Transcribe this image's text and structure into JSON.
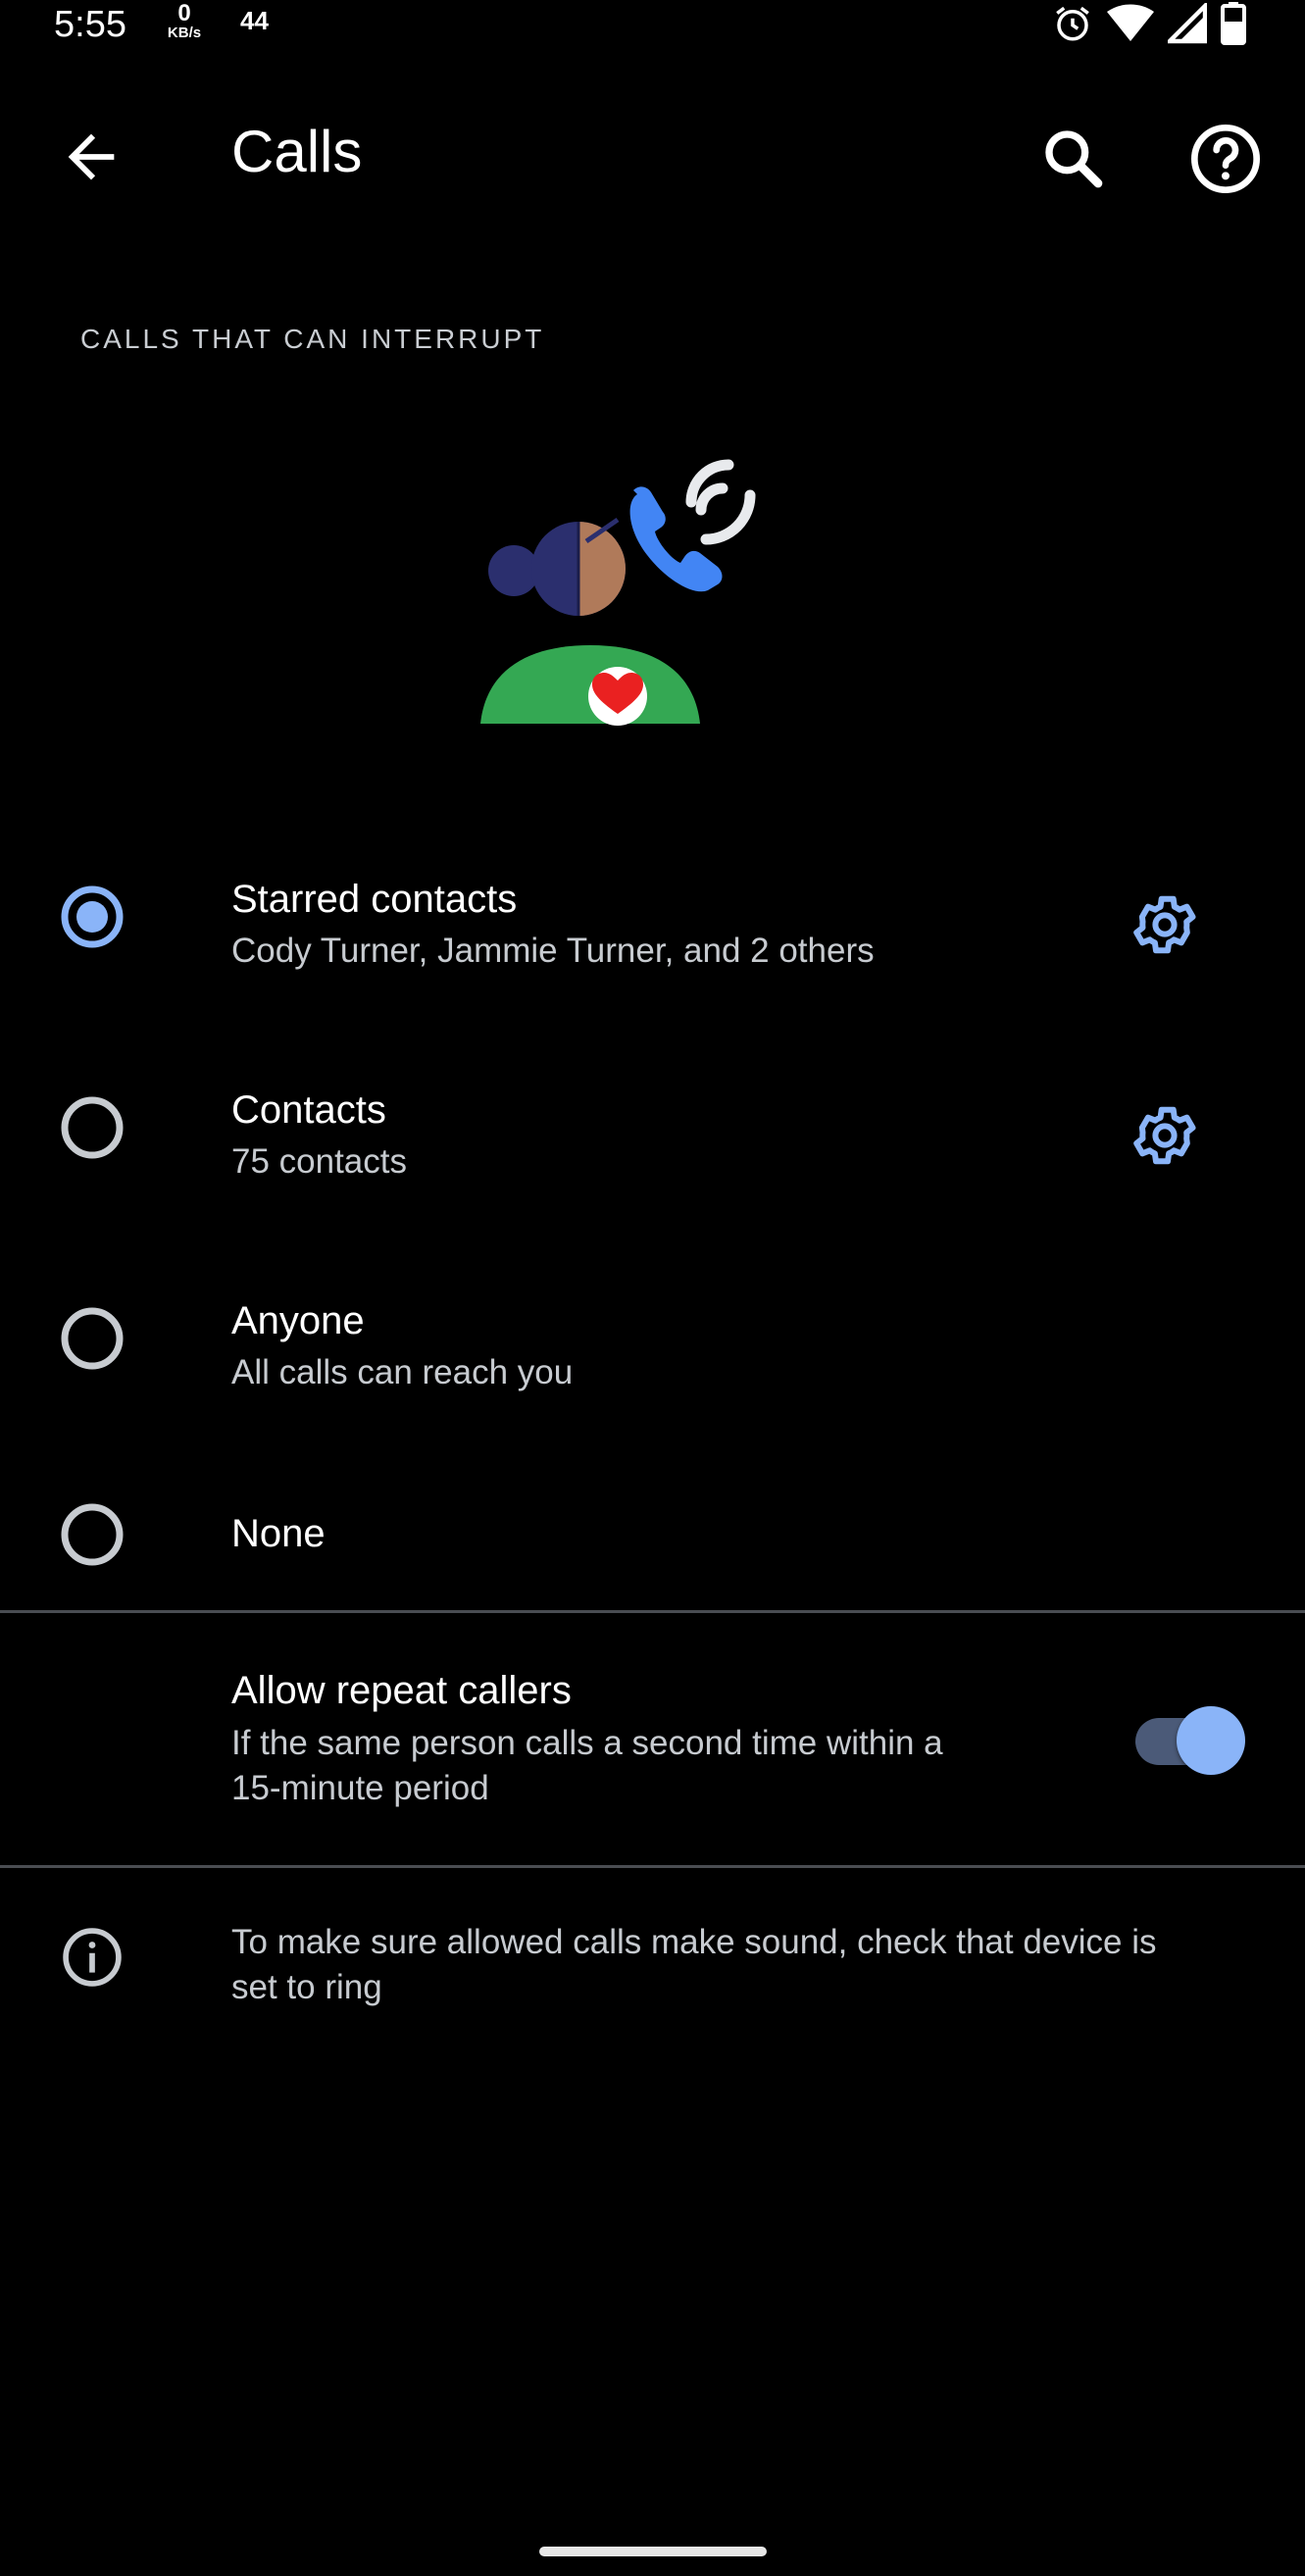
{
  "status_bar": {
    "time": "5:55",
    "speed_value": "0",
    "speed_unit": "KB/s",
    "extra": "44",
    "icons": [
      "alarm-icon",
      "wifi-icon",
      "signal-icon",
      "battery-icon"
    ]
  },
  "app_bar": {
    "title": "Calls",
    "back_icon": "arrow-back-icon",
    "search_icon": "search-icon",
    "help_icon": "help-icon"
  },
  "section_header": "CALLS THAT CAN INTERRUPT",
  "options": [
    {
      "title": "Starred contacts",
      "subtitle": "Cody Turner, Jammie Turner, and 2 others",
      "selected": true,
      "has_settings": true
    },
    {
      "title": "Contacts",
      "subtitle": "75 contacts",
      "selected": false,
      "has_settings": true
    },
    {
      "title": "Anyone",
      "subtitle": "All calls can reach you",
      "selected": false,
      "has_settings": false
    },
    {
      "title": "None",
      "subtitle": "",
      "selected": false,
      "has_settings": false
    }
  ],
  "repeat_callers": {
    "title": "Allow repeat callers",
    "subtitle_line1": "If the same person calls a second time within a",
    "subtitle_line2": "15-minute period",
    "enabled": true
  },
  "info": {
    "icon": "info-icon",
    "text_line1": "To make sure allowed calls make sound, check that device is",
    "text_line2": "set to ring"
  },
  "colors": {
    "background": "#000000",
    "accent": "#8ab4f8",
    "secondary_text": "#c7cbd0"
  }
}
